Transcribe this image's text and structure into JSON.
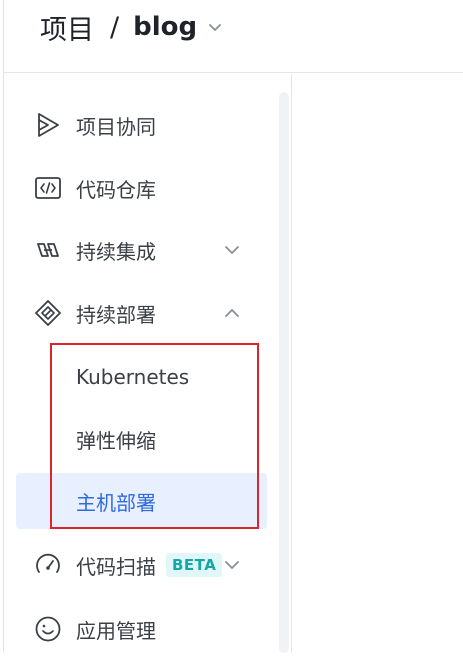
{
  "header": {
    "project_label": "项目",
    "separator": "/",
    "repo_name": "blog",
    "caret_icon": "chevron-down-icon"
  },
  "sidebar": {
    "items": [
      {
        "label": "项目协同",
        "icon": "play-triangle-icon"
      },
      {
        "label": "代码仓库",
        "icon": "code-brackets-icon"
      },
      {
        "label": "持续集成",
        "icon": "infinity-links-icon",
        "expanded": false
      },
      {
        "label": "持续部署",
        "icon": "deploy-diamond-icon",
        "expanded": true
      },
      {
        "label": "代码扫描",
        "icon": "gauge-icon",
        "badge": "BETA",
        "expanded": false
      },
      {
        "label": "应用管理",
        "icon": "smile-circle-icon"
      }
    ],
    "deploy_subitems": [
      {
        "label": "Kubernetes",
        "active": false
      },
      {
        "label": "弹性伸缩",
        "active": false
      },
      {
        "label": "主机部署",
        "active": true
      }
    ]
  },
  "colors": {
    "active_bg": "#e8efff",
    "active_text": "#2f6bdb",
    "badge_bg": "#e1f7f7",
    "badge_text": "#15a6a6",
    "highlight_border": "#d9262c"
  }
}
